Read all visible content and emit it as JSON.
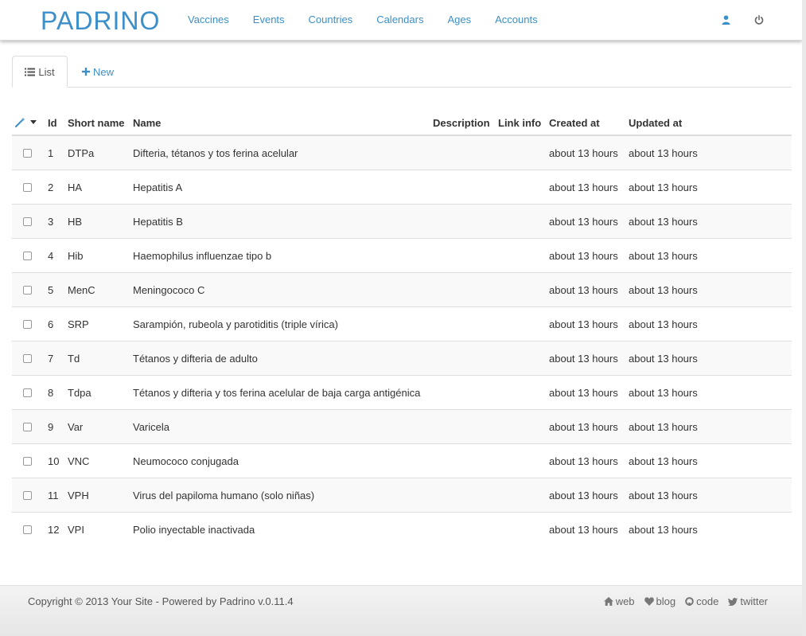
{
  "navbar": {
    "brand": "PADRINO",
    "links": [
      "Vaccines",
      "Events",
      "Countries",
      "Calendars",
      "Ages",
      "Accounts"
    ],
    "icons": {
      "profile": "user-icon",
      "logout": "power-icon"
    },
    "accent": "#3c8fc9"
  },
  "tabs": {
    "list": "List",
    "new": "New"
  },
  "table": {
    "headers": {
      "id": "Id",
      "short_name": "Short name",
      "name": "Name",
      "description": "Description",
      "link_info": "Link info",
      "created_at": "Created at",
      "updated_at": "Updated at"
    },
    "rows": [
      {
        "id": "1",
        "short": "DTPa",
        "name": "Difteria, tétanos y tos ferina acelular",
        "description": "",
        "link": "",
        "created": "about 13 hours",
        "updated": "about 13 hours"
      },
      {
        "id": "2",
        "short": "HA",
        "name": "Hepatitis A",
        "description": "",
        "link": "",
        "created": "about 13 hours",
        "updated": "about 13 hours"
      },
      {
        "id": "3",
        "short": "HB",
        "name": "Hepatitis B",
        "description": "",
        "link": "",
        "created": "about 13 hours",
        "updated": "about 13 hours"
      },
      {
        "id": "4",
        "short": "Hib",
        "name": "Haemophilus influenzae tipo b",
        "description": "",
        "link": "",
        "created": "about 13 hours",
        "updated": "about 13 hours"
      },
      {
        "id": "5",
        "short": "MenC",
        "name": "Meningococo C",
        "description": "",
        "link": "",
        "created": "about 13 hours",
        "updated": "about 13 hours"
      },
      {
        "id": "6",
        "short": "SRP",
        "name": "Sarampión, rubeola y parotiditis (triple vírica)",
        "description": "",
        "link": "",
        "created": "about 13 hours",
        "updated": "about 13 hours"
      },
      {
        "id": "7",
        "short": "Td",
        "name": "Tétanos y difteria de adulto",
        "description": "",
        "link": "",
        "created": "about 13 hours",
        "updated": "about 13 hours"
      },
      {
        "id": "8",
        "short": "Tdpa",
        "name": "Tétanos y difteria y tos ferina acelular de baja carga antigénica",
        "description": "",
        "link": "",
        "created": "about 13 hours",
        "updated": "about 13 hours"
      },
      {
        "id": "9",
        "short": "Var",
        "name": "Varicela",
        "description": "",
        "link": "",
        "created": "about 13 hours",
        "updated": "about 13 hours"
      },
      {
        "id": "10",
        "short": "VNC",
        "name": "Neumococo conjugada",
        "description": "",
        "link": "",
        "created": "about 13 hours",
        "updated": "about 13 hours"
      },
      {
        "id": "11",
        "short": "VPH",
        "name": "Virus del papiloma humano (solo niñas)",
        "description": "",
        "link": "",
        "created": "about 13 hours",
        "updated": "about 13 hours"
      },
      {
        "id": "12",
        "short": "VPI",
        "name": "Polio inyectable inactivada",
        "description": "",
        "link": "",
        "created": "about 13 hours",
        "updated": "about 13 hours"
      }
    ]
  },
  "footer": {
    "copyright": "Copyright © 2013 Your Site - Powered by Padrino v.0.11.4",
    "links": [
      {
        "label": "web",
        "icon": "home-icon"
      },
      {
        "label": "blog",
        "icon": "heart-icon"
      },
      {
        "label": "code",
        "icon": "github-icon"
      },
      {
        "label": "twitter",
        "icon": "twitter-icon"
      }
    ]
  }
}
